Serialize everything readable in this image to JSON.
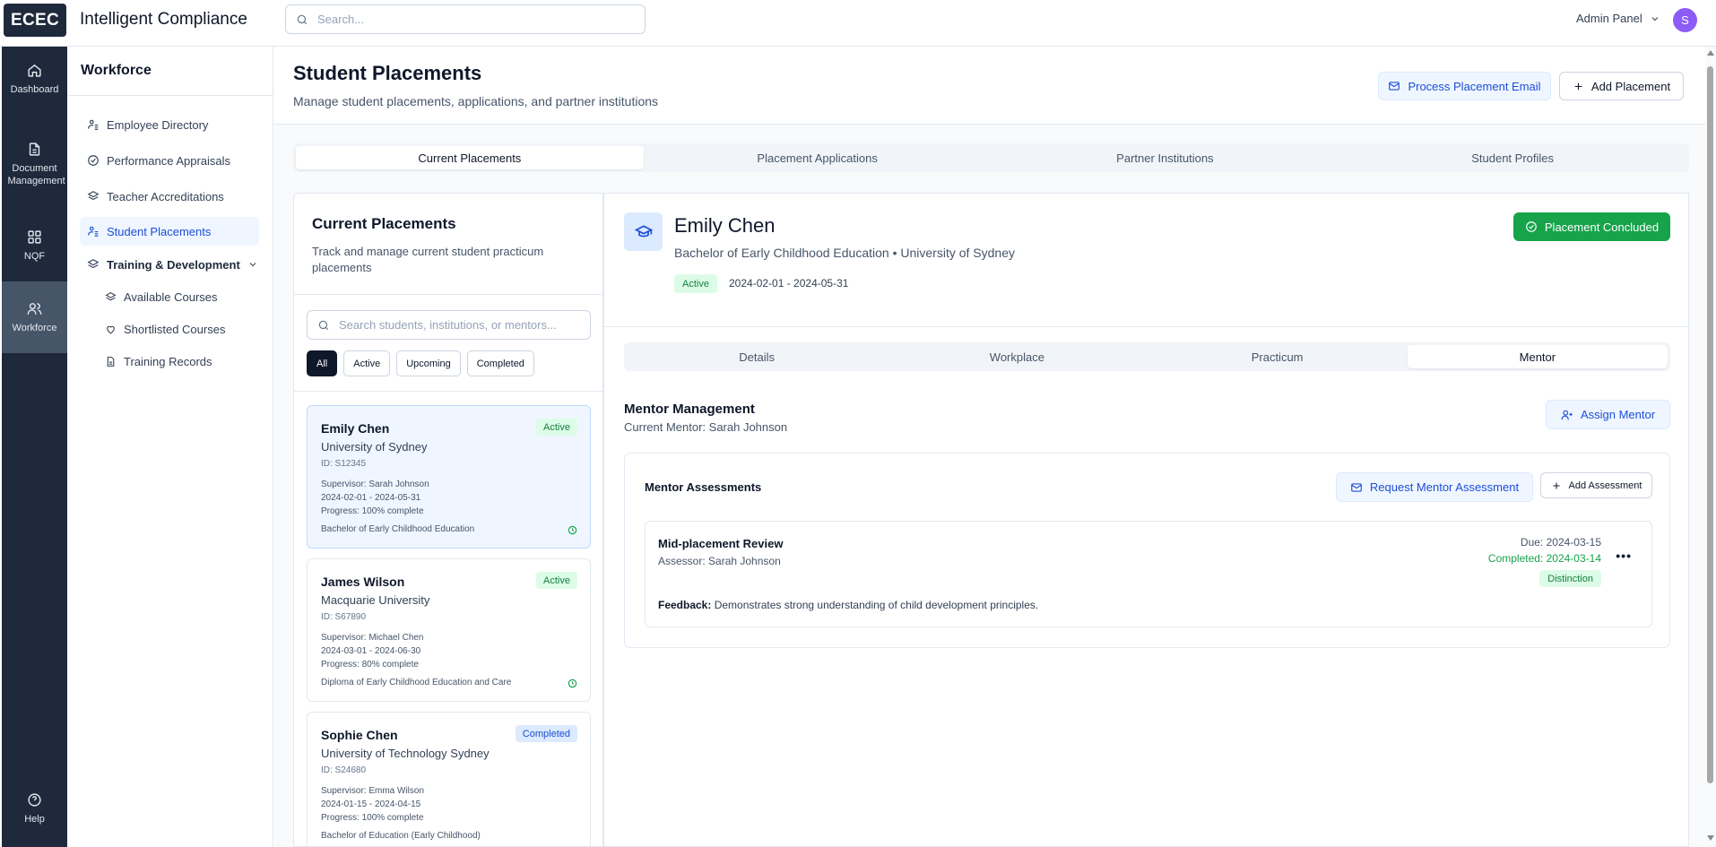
{
  "app": {
    "logo": "ECEC",
    "title": "Intelligent Compliance"
  },
  "topbar": {
    "search_placeholder": "Search...",
    "admin_label": "Admin Panel",
    "avatar_initial": "S"
  },
  "rail": {
    "dashboard": "Dashboard",
    "document_management": "Document Management",
    "nqf": "NQF",
    "workforce": "Workforce",
    "help": "Help"
  },
  "sidebar": {
    "title": "Workforce",
    "items": [
      {
        "label": "Employee Directory",
        "icon": "user-list-icon"
      },
      {
        "label": "Performance Appraisals",
        "icon": "check-circle-icon"
      },
      {
        "label": "Teacher Accreditations",
        "icon": "layers-icon"
      },
      {
        "label": "Student Placements",
        "icon": "user-list-icon",
        "active": true
      },
      {
        "label": "Training & Development",
        "icon": "layers-icon"
      },
      {
        "label": "Available Courses",
        "icon": "layers-icon"
      },
      {
        "label": "Shortlisted Courses",
        "icon": "heart-icon"
      },
      {
        "label": "Training Records",
        "icon": "file-icon"
      }
    ]
  },
  "page": {
    "title": "Student Placements",
    "subtitle": "Manage student placements, applications, and partner institutions",
    "process_email_label": "Process Placement Email",
    "add_placement_label": "Add Placement"
  },
  "main_tabs": [
    "Current Placements",
    "Placement Applications",
    "Partner Institutions",
    "Student Profiles"
  ],
  "list": {
    "title": "Current Placements",
    "subtitle": "Track and manage current student practicum placements",
    "search_placeholder": "Search students, institutions, or mentors...",
    "filters": [
      "All",
      "Active",
      "Upcoming",
      "Completed"
    ],
    "cards": [
      {
        "name": "Emily Chen",
        "institution": "University of Sydney",
        "id": "ID: S12345",
        "supervisor": "Supervisor: Sarah Johnson",
        "dates": "2024-02-01 - 2024-05-31",
        "progress": "Progress: 100% complete",
        "course": "Bachelor of Early Childhood Education",
        "status": "Active"
      },
      {
        "name": "James Wilson",
        "institution": "Macquarie University",
        "id": "ID: S67890",
        "supervisor": "Supervisor: Michael Chen",
        "dates": "2024-03-01 - 2024-06-30",
        "progress": "Progress: 80% complete",
        "course": "Diploma of Early Childhood Education and Care",
        "status": "Active"
      },
      {
        "name": "Sophie Chen",
        "institution": "University of Technology Sydney",
        "id": "ID: S24680",
        "supervisor": "Supervisor: Emma Wilson",
        "dates": "2024-01-15 - 2024-04-15",
        "progress": "Progress: 100% complete",
        "course": "Bachelor of Education (Early Childhood)",
        "status": "Completed"
      }
    ]
  },
  "detail": {
    "name": "Emily Chen",
    "course_line": "Bachelor of Early Childhood Education • University of Sydney",
    "status": "Active",
    "dates": "2024-02-01 - 2024-05-31",
    "concluded_label": "Placement Concluded",
    "tabs": [
      "Details",
      "Workplace",
      "Practicum",
      "Mentor"
    ],
    "mentor": {
      "title": "Mentor Management",
      "current": "Current Mentor: Sarah Johnson",
      "assign_label": "Assign Mentor",
      "assessments_title": "Mentor Assessments",
      "request_label": "Request Mentor Assessment",
      "add_label": "Add Assessment",
      "review": {
        "title": "Mid-placement Review",
        "assessor": "Assessor: Sarah Johnson",
        "due": "Due: 2024-03-15",
        "completed": "Completed: 2024-03-14",
        "grade": "Distinction",
        "feedback_label": "Feedback:",
        "feedback": " Demonstrates strong understanding of child development principles."
      }
    }
  },
  "colors": {
    "primary": "#1d4ed8",
    "rail": "#1e293b",
    "success": "#16a34a",
    "avatar": "#8b5cf6"
  }
}
